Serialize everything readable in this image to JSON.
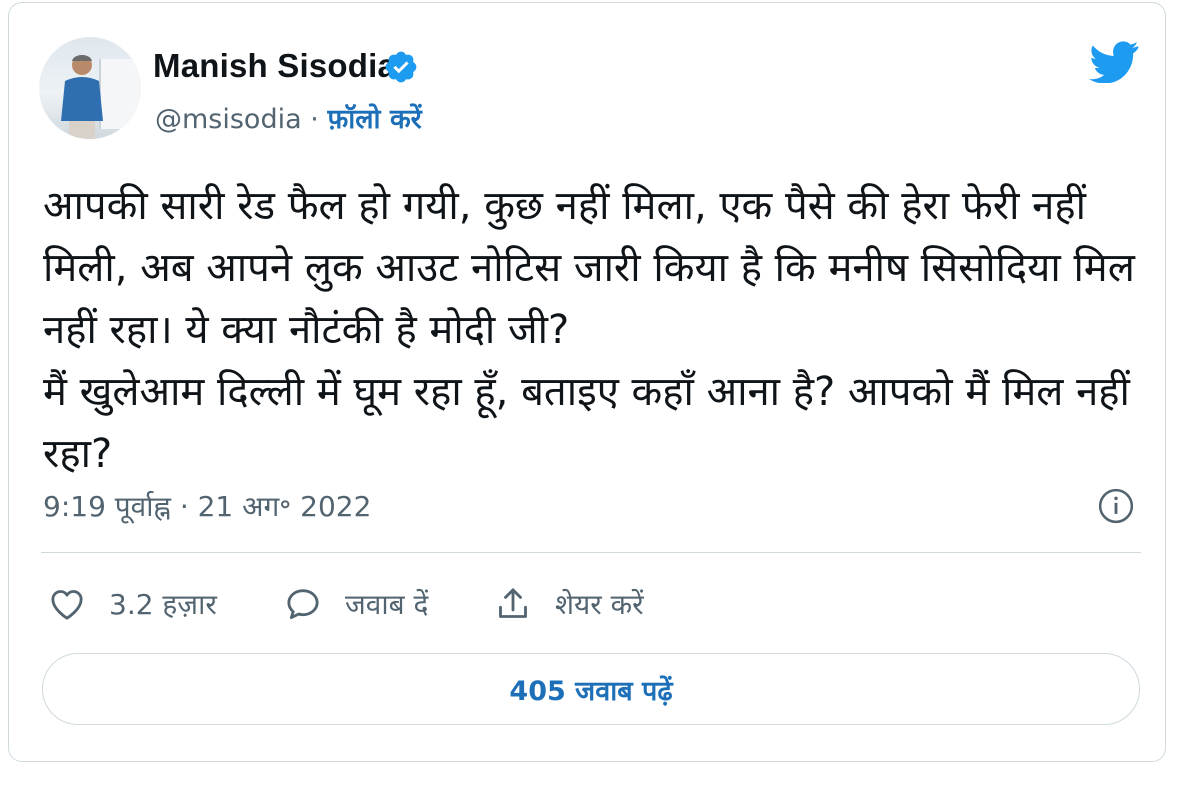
{
  "author": {
    "name": "Manish Sisodia",
    "handle": "@msisodia",
    "separator": "·",
    "follow_label": "फ़ॉलो करें"
  },
  "tweet": {
    "lines": [
      "आपकी सारी रेड फैल हो गयी, कुछ नहीं मिला, एक पैसे की हेरा फेरी नहीं मिली, अब आपने लुक आउट नोटिस जारी किया है कि मनीष सिसोदिया मिल नहीं रहा। ये क्या नौटंकी है मोदी जी?",
      "मैं खुलेआम दिल्ली में घूम रहा हूँ, बताइए कहाँ आना है? आपको मैं मिल नहीं रहा?"
    ],
    "timestamp": "9:19 पूर्वाह्न · 21 अग॰ 2022"
  },
  "actions": {
    "like_count": "3.2 हज़ार",
    "reply_label": "जवाब दें",
    "share_label": "शेयर करें"
  },
  "read_replies_label": "405 जवाब पढ़ें",
  "colors": {
    "accent": "#1d6fb8",
    "twitter_blue": "#1d9bf0",
    "secondary_text": "#536471",
    "border": "#cfd9de"
  },
  "icons": {
    "logo": "twitter-bird-icon",
    "verified": "verified-badge-icon",
    "info": "info-icon",
    "like": "heart-icon",
    "reply": "speech-bubble-icon",
    "share": "share-upload-icon"
  }
}
